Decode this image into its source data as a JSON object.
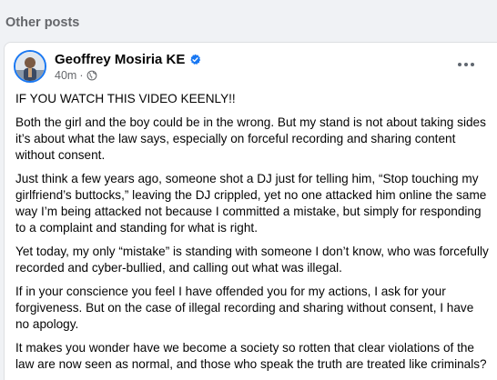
{
  "section": {
    "heading": "Other posts"
  },
  "post": {
    "author": "Geoffrey Mosiria KE",
    "verified_icon": "verified-badge-icon",
    "time": "40m",
    "audience_icon": "globe-icon",
    "more_icon": "more-options-icon",
    "paragraphs": [
      "IF YOU WATCH THIS VIDEO KEENLY!!",
      "Both the girl and the boy could be in the wrong. But my stand is not about taking sides it’s about what the law says, especially on forceful recording and sharing content without consent.",
      "Just think a few years ago, someone shot a DJ just for telling him, “Stop touching my girlfriend’s buttocks,” leaving the DJ crippled, yet no one attacked him online the same way I’m being attacked not because I committed a mistake, but simply for responding to a complaint and standing for what is right.",
      "Yet today, my only “mistake” is standing with someone I don’t know, who was forcefully recorded and cyber-bullied, and calling out what was illegal.",
      "If in your conscience you feel I have offended you for my actions, I ask for your forgiveness. But on the case of illegal recording and sharing without consent, I have no apology.",
      "It makes you wonder have we become a society so rotten that clear violations of the law are now seen as normal, and those who speak the truth are treated like criminals?"
    ]
  },
  "colors": {
    "accent": "#1877f2",
    "secondary_text": "#65676b",
    "page_background": "#f0f2f5"
  }
}
